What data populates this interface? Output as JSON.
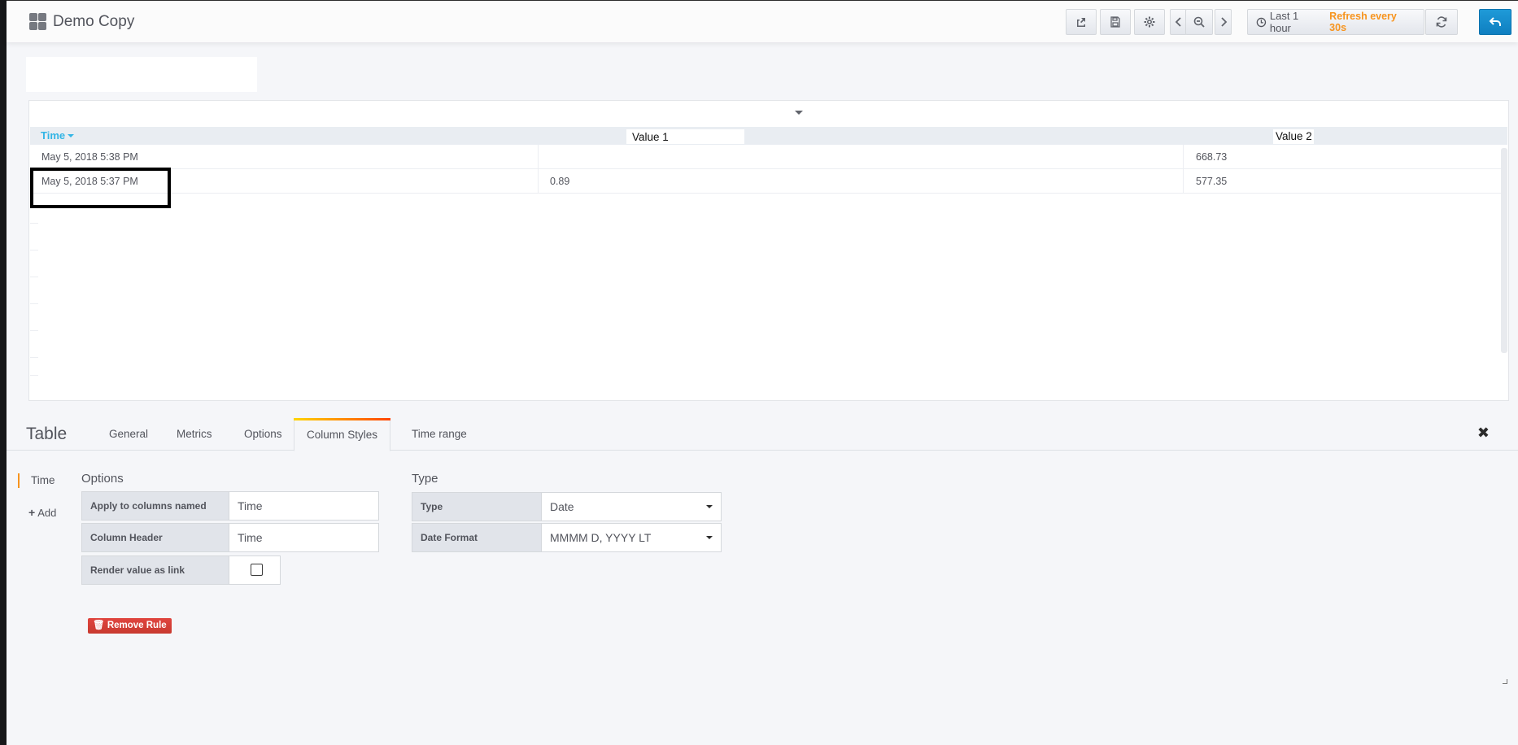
{
  "navbar": {
    "dashboard_title": "Demo Copy",
    "time_range": "Last 1 hour",
    "refresh": "Refresh every 30s",
    "icons": [
      "share-icon",
      "save-icon",
      "gear-icon",
      "chevron-left-icon",
      "zoom-out-icon",
      "chevron-right-icon",
      "clock-icon",
      "refresh-icon",
      "back-icon"
    ]
  },
  "table": {
    "headers": {
      "time": "Time",
      "value1": "Value 1",
      "value2": "Value 2"
    },
    "rows": [
      {
        "time": "May 5, 2018 5:38 PM",
        "value1": "",
        "value2": "668.73"
      },
      {
        "time": "May 5, 2018 5:37 PM",
        "value1": "0.89",
        "value2": "577.35"
      }
    ]
  },
  "editor": {
    "title": "Table",
    "tabs": [
      "General",
      "Metrics",
      "Options",
      "Column Styles",
      "Time range"
    ],
    "active_tab": "Column Styles",
    "close": "✖",
    "sidebar": {
      "selected_rule": "Time",
      "add_label": "Add"
    },
    "options": {
      "title": "Options",
      "apply_label": "Apply to columns named",
      "apply_value": "Time",
      "header_label": "Column Header",
      "header_value": "Time",
      "link_label": "Render value as link",
      "link_checked": false
    },
    "type": {
      "title": "Type",
      "type_label": "Type",
      "type_value": "Date",
      "date_format_label": "Date Format",
      "date_format_value": "MMMM D, YYYY LT"
    },
    "remove_rule": "Remove Rule"
  },
  "colors": {
    "accent_blue": "#33b5e5",
    "refresh_orange": "#f7941e",
    "danger": "#e0443e",
    "primary": "#1f9ad8"
  }
}
